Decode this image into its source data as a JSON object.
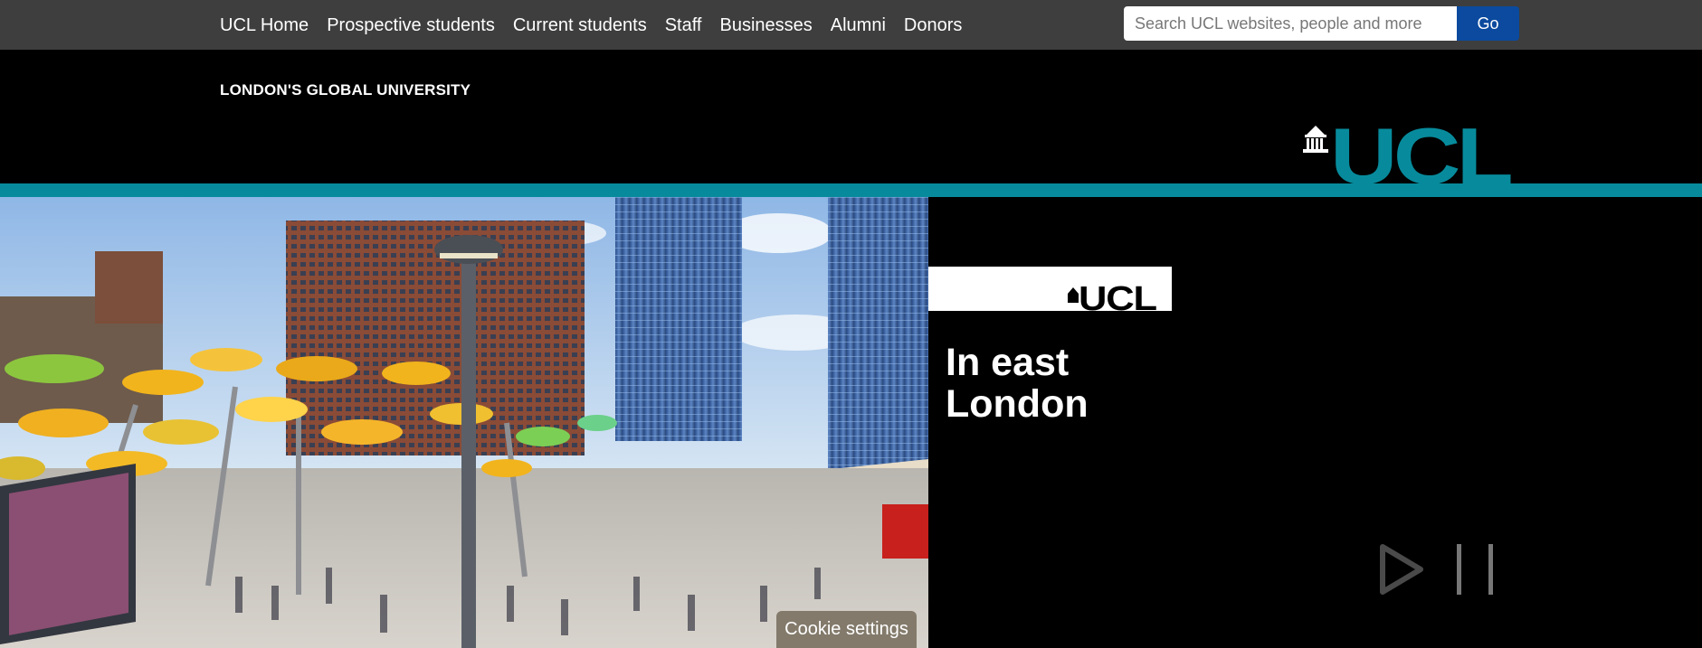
{
  "topnav": {
    "links": [
      "UCL Home",
      "Prospective students",
      "Current students",
      "Staff",
      "Businesses",
      "Alumni",
      "Donors"
    ]
  },
  "search": {
    "placeholder": "Search UCL websites, people and more",
    "button_label": "Go"
  },
  "header": {
    "tagline": "LONDON'S GLOBAL UNIVERSITY",
    "logo_text": "UCL"
  },
  "hero": {
    "panel_logo_text": "UCL",
    "title": "In east London",
    "controls": {
      "play_icon": "play-icon",
      "pause_icon": "pause-icon"
    }
  },
  "cookie": {
    "label": "Cookie settings"
  },
  "colors": {
    "topbar": "#3e3e3e",
    "teal": "#078b9c",
    "go_button": "#0b4a9e",
    "cookie": "#837a6b"
  }
}
